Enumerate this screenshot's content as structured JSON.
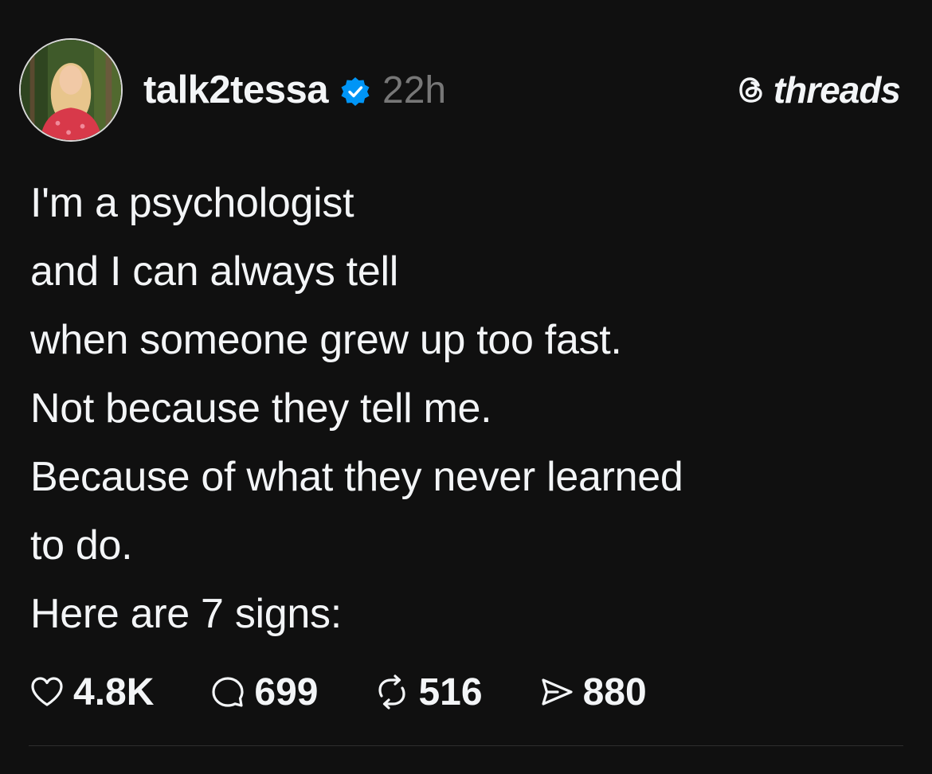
{
  "post": {
    "username": "talk2tessa",
    "timestamp": "22h",
    "verified": true,
    "lines": [
      "I'm a psychologist",
      "and I can always tell",
      "when someone grew up too fast.",
      "Not because they tell me.",
      "Because of what they never learned",
      "to do.",
      "Here are 7 signs:"
    ]
  },
  "brand": {
    "name": "threads",
    "icon": "threads-logo-icon"
  },
  "actions": {
    "likes": "4.8K",
    "replies": "699",
    "reposts": "516",
    "shares": "880"
  },
  "colors": {
    "background": "#101010",
    "text": "#f3f5f7",
    "muted": "#777777",
    "verified": "#0095f6"
  }
}
